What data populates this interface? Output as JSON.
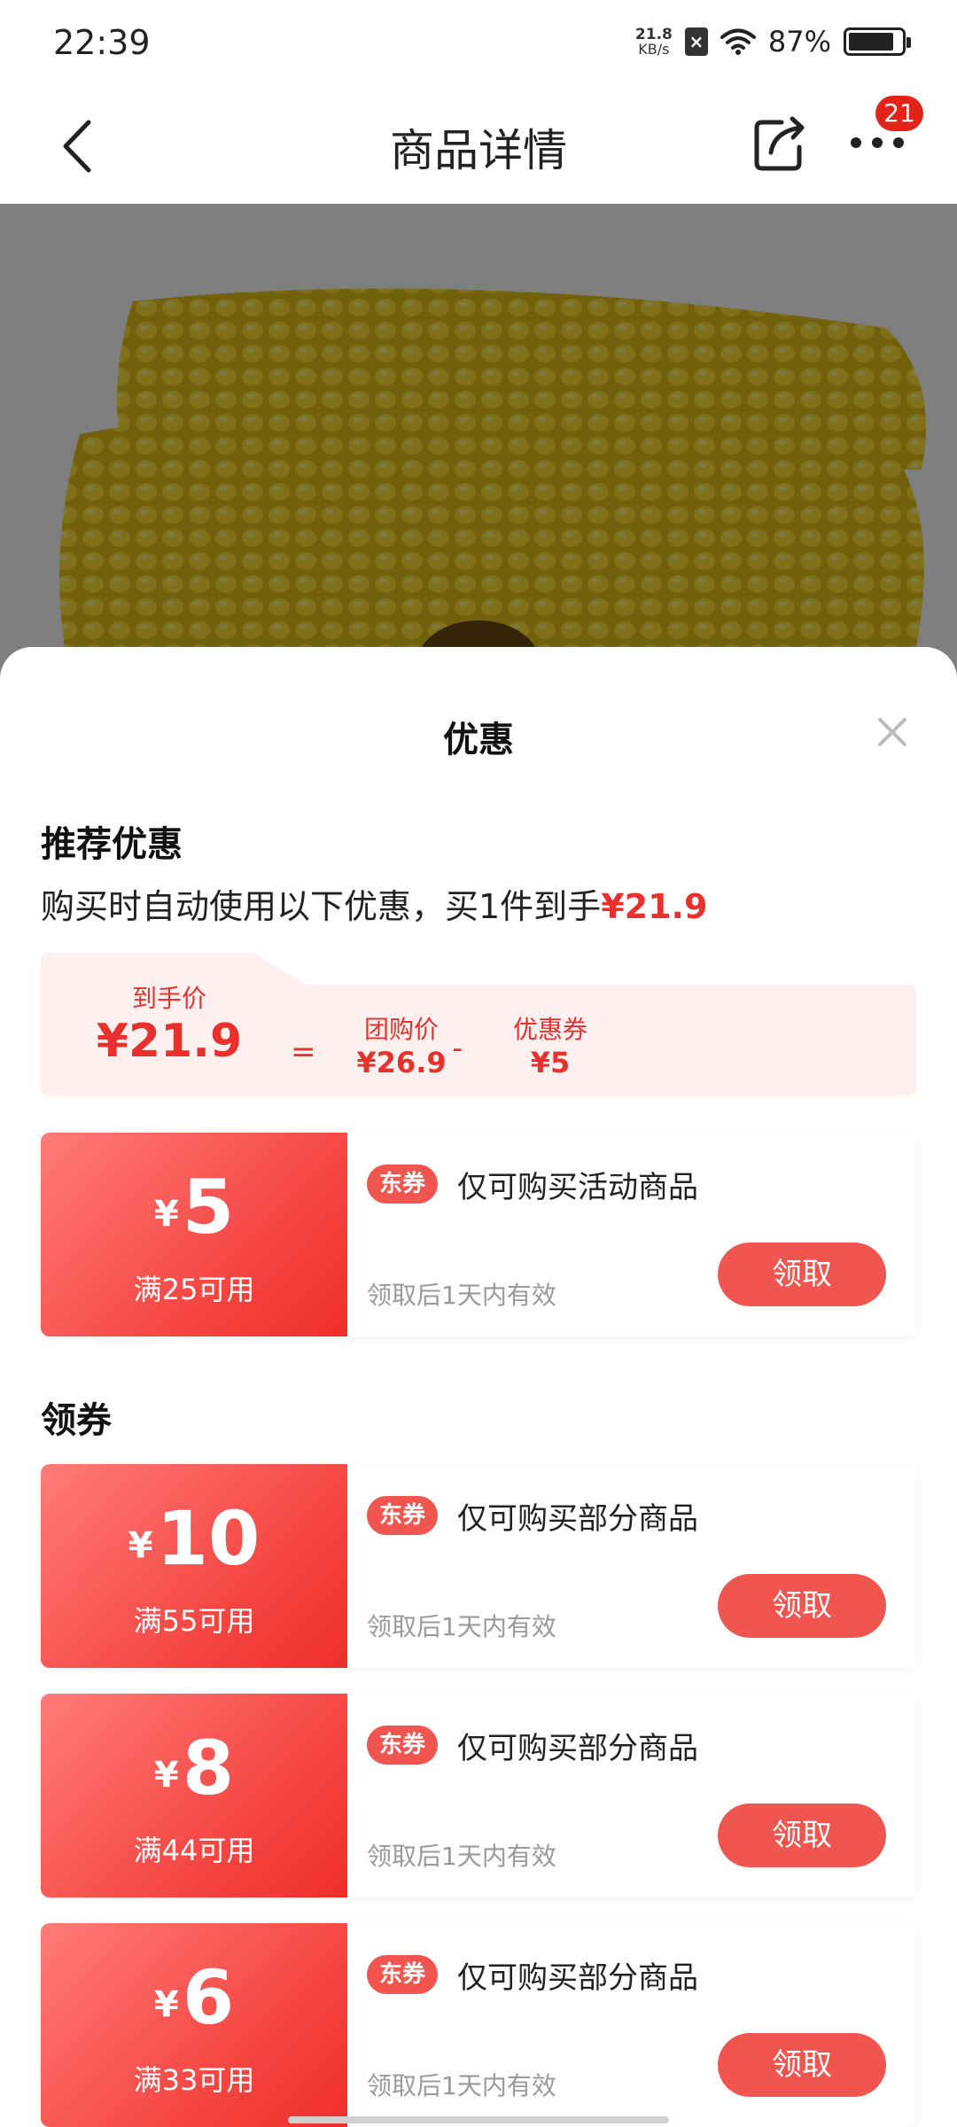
{
  "status_bar": {
    "time": "22:39",
    "net_speed_value": "21.8",
    "net_speed_unit": "KB/s",
    "battery": "87%",
    "battery_level": 0.87
  },
  "nav": {
    "title": "商品详情",
    "more_badge": "21"
  },
  "sheet": {
    "title": "优惠",
    "recommend": {
      "title": "推荐优惠",
      "desc_prefix": "购买时自动使用以下优惠，买1件到手",
      "desc_price": "¥21.9"
    },
    "breakdown": {
      "final_label": "到手价",
      "final_value": "¥21.9",
      "equals": "=",
      "group_label": "团购价",
      "group_value": "¥26.9",
      "minus": "-",
      "coupon_label": "优惠券",
      "coupon_value": "¥5"
    },
    "coupons_section_title": "领券",
    "coupons": [
      {
        "yen": "¥",
        "amount": "5",
        "condition": "满25可用",
        "tag": "东券",
        "desc": "仅可购买活动商品",
        "validity": "领取后1天内有效",
        "button": "领取"
      },
      {
        "yen": "¥",
        "amount": "10",
        "condition": "满55可用",
        "tag": "东券",
        "desc": "仅可购买部分商品",
        "validity": "领取后1天内有效",
        "button": "领取"
      },
      {
        "yen": "¥",
        "amount": "8",
        "condition": "满44可用",
        "tag": "东券",
        "desc": "仅可购买部分商品",
        "validity": "领取后1天内有效",
        "button": "领取"
      },
      {
        "yen": "¥",
        "amount": "6",
        "condition": "满33可用",
        "tag": "东券",
        "desc": "仅可购买部分商品",
        "validity": "领取后1天内有效",
        "button": "领取"
      }
    ]
  },
  "colors": {
    "accent_red": "#e8302d",
    "button_red": "#f0564f",
    "price_box_bg": "#fff0f0",
    "overlay": "rgba(0,0,0,0.5)"
  },
  "icons": [
    "back-arrow-icon",
    "share-icon",
    "more-icon",
    "close-icon",
    "wifi-icon",
    "sim-icon",
    "battery-icon"
  ]
}
